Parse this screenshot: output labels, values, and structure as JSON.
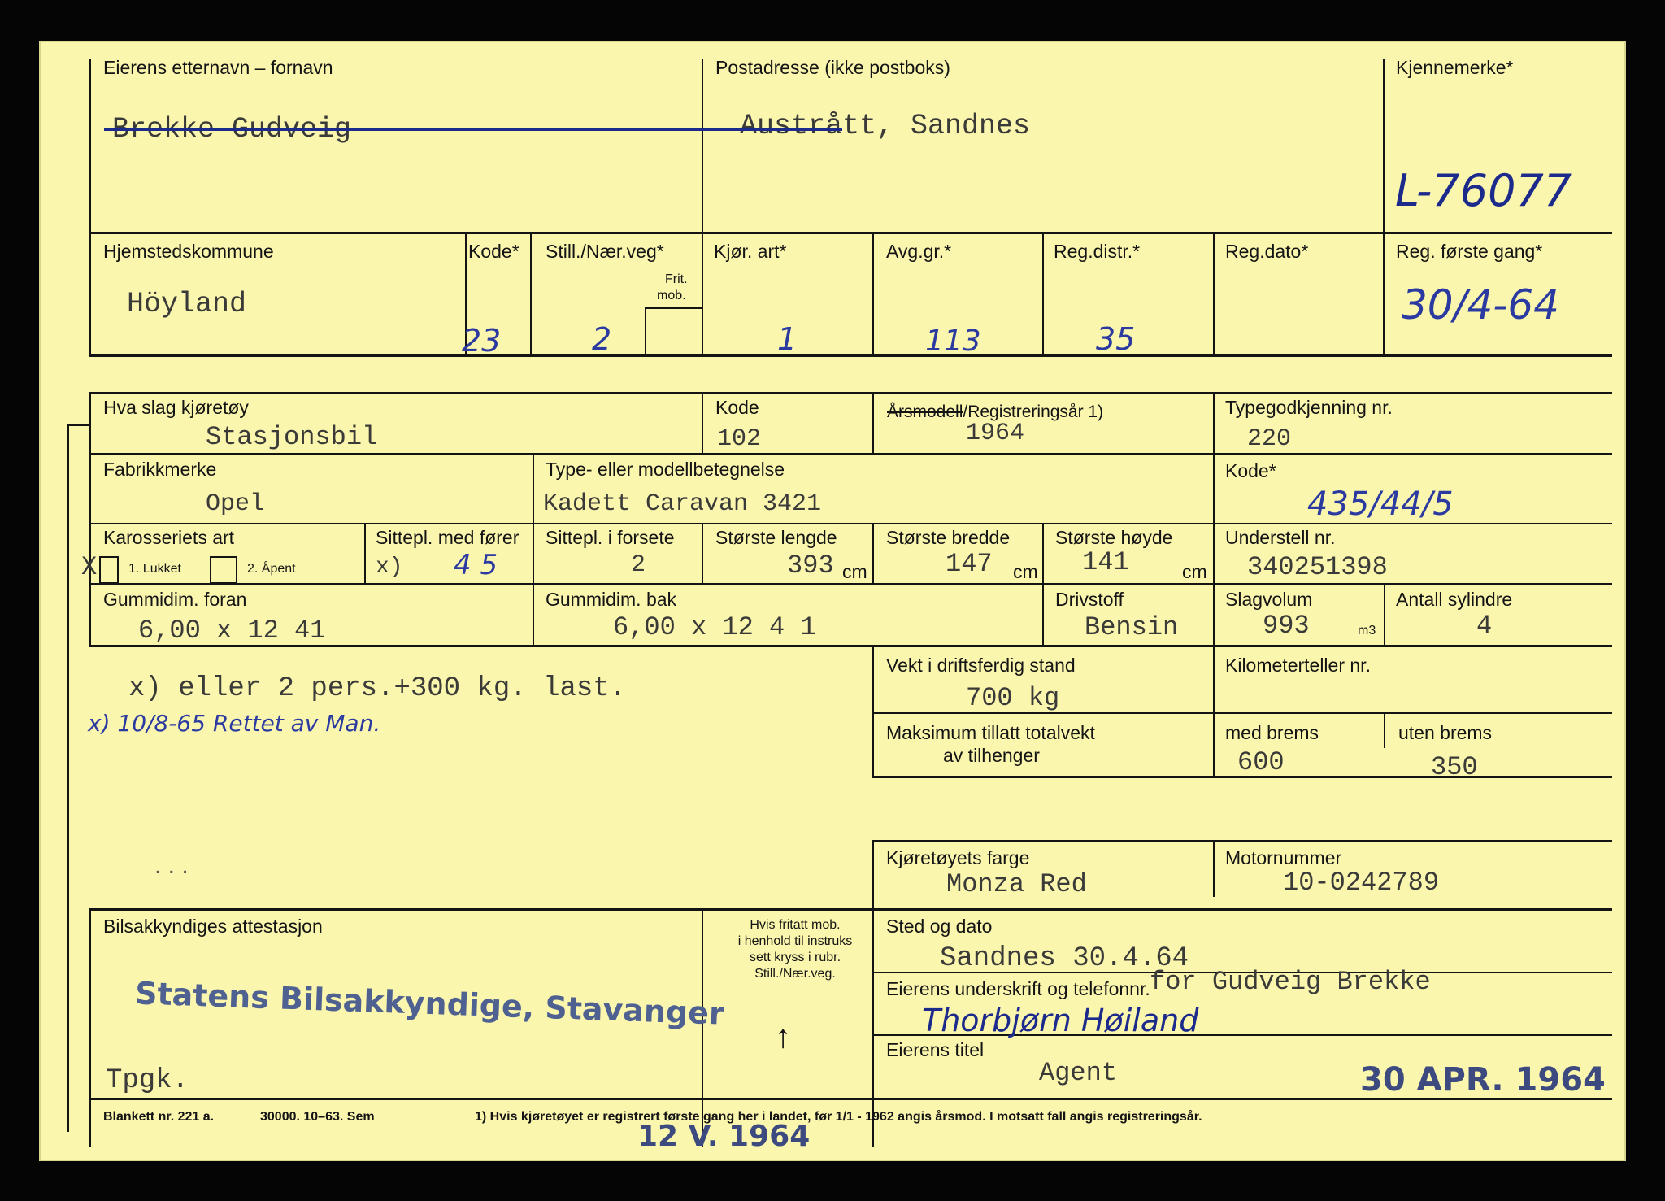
{
  "owner": {
    "name_label": "Eierens etternavn – fornavn",
    "name_value": "Brekke Gudveig",
    "address_label": "Postadresse (ikke postboks)",
    "address_value": "Austrått, Sandnes",
    "plate_label": "Kjennemerke*",
    "plate_value": "L-76077"
  },
  "codes": {
    "municipality_label": "Hjemstedskommune",
    "municipality_value": "Höyland",
    "kode_label": "Kode*",
    "kode_value": "23",
    "still_label": "Still./Nær.veg*",
    "frit_label_1": "Frit.",
    "frit_label_2": "mob.",
    "still_value": "2",
    "kjor_label": "Kjør. art*",
    "kjor_value": "1",
    "avg_label": "Avg.gr.*",
    "avg_value": "113",
    "regdistr_label": "Reg.distr.*",
    "regdistr_value": "35",
    "regdato_label": "Reg.dato*",
    "regforste_label": "Reg. første gang*",
    "regforste_value": "30/4-64"
  },
  "vehicle": {
    "type_label": "Hva slag kjøretøy",
    "type_value": "Stasjonsbil",
    "kode_label": "Kode",
    "kode_value": "102",
    "year_label_struck": "Årsmodell",
    "year_label_rest": "/Registreringsår 1)",
    "year_value": "1964",
    "typegodk_label": "Typegodkjenning nr.",
    "typegodk_value": "220",
    "make_label": "Fabrikkmerke",
    "make_value": "Opel",
    "model_label": "Type- eller modellbetegnelse",
    "model_value": "Kadett Caravan 3421",
    "kode2_label": "Kode*",
    "kode2_value": "435/44/5",
    "body_label": "Karosseriets art",
    "body_opt1": "1. Lukket",
    "body_opt2": "2. Åpent",
    "body_mark": "X",
    "seats_label": "Sittepl. med fører",
    "seats_value_prefix": "x)",
    "seats_value": "4 5",
    "seats_front_label": "Sittepl. i forsete",
    "seats_front_value": "2",
    "length_label": "Største lengde",
    "length_value": "393",
    "length_unit": "cm",
    "width_label": "Største bredde",
    "width_value": "147",
    "width_unit": "cm",
    "height_label": "Største høyde",
    "height_value": "141",
    "height_unit": "cm",
    "chassis_label": "Understell nr.",
    "chassis_value": "340251398",
    "tire_front_label": "Gummidim. foran",
    "tire_front_value": "6,00 x 12 41",
    "tire_back_label": "Gummidim. bak",
    "tire_back_value": "6,00 x 12 4 1",
    "fuel_label": "Drivstoff",
    "fuel_value": "Bensin",
    "displacement_label": "Slagvolum",
    "displacement_value": "993",
    "displacement_unit": "m3",
    "cylinders_label": "Antall sylindre",
    "cylinders_value": "4"
  },
  "notes": {
    "typed_note": "x) eller 2 pers.+300 kg. last.",
    "hand_note": "x) 10/8-65 Rettet av Man."
  },
  "weights": {
    "weight_label": "Vekt i driftsferdig stand",
    "weight_value": "700 kg",
    "odometer_label": "Kilometerteller nr.",
    "trailer_label_1": "Maksimum tillatt totalvekt",
    "trailer_label_2": "av tilhenger",
    "brake_label": "med brems",
    "brake_value": "600",
    "nobrake_label": "uten brems",
    "nobrake_value": "350"
  },
  "color": {
    "color_label": "Kjøretøyets farge",
    "color_value": "Monza Red",
    "engine_label": "Motornummer",
    "engine_value": "10-0242789"
  },
  "attest": {
    "label": "Bilsakkyndiges attestasjon",
    "stamp": "Statens Bilsakkyndige, Stavanger",
    "tpgk": "Tpgk.",
    "note_lines": [
      "Hvis fritatt mob.",
      "i henhold til instruks",
      "sett kryss i rubr.",
      "Still./Nær.veg."
    ],
    "arrow": "↑",
    "place_label": "Sted og dato",
    "place_value": "Sandnes 30.4.64",
    "signature_label": "Eierens underskrift og telefonnr.",
    "signature_for": "for Gudveig Brekke",
    "signature_hand": "Thorbjørn Høiland",
    "title_label": "Eierens titel",
    "title_value": "Agent",
    "date_stamp": "30 APR. 1964"
  },
  "footer": {
    "blankett": "Blankett nr. 221 a.",
    "print": "30000. 10–63. Sem",
    "footnote": "1)  Hvis kjøretøyet er registrert første gang her i landet, før 1/1 - 1962 angis årsmod.  I motsatt fall angis registreringsår.",
    "stamp2": "12 V. 1964"
  }
}
